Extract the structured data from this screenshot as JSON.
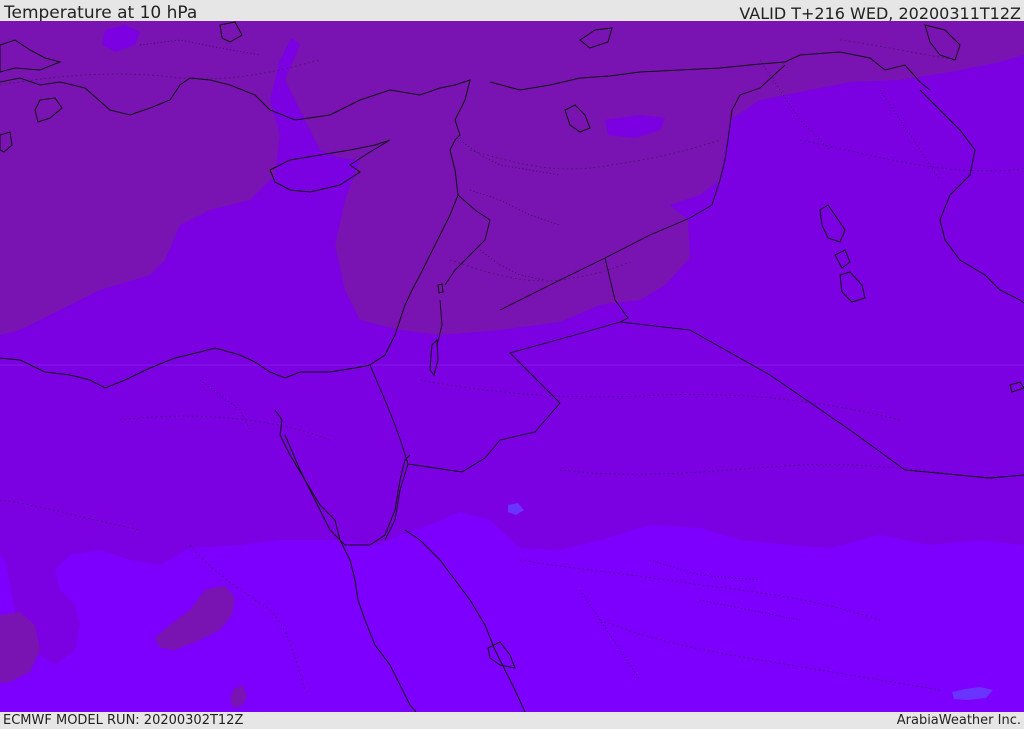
{
  "header": {
    "title": "Temperature at 10 hPa",
    "valid": "VALID T+216 WED, 20200311T12Z"
  },
  "footer": {
    "model_run": "ECMWF MODEL RUN: 20200302T12Z",
    "credit": "ArabiaWeather Inc."
  },
  "map": {
    "colors": {
      "dark_band": "#7913b2",
      "mid_band": "#7b00e2",
      "light_band": "#7d00ff",
      "light_patch": "#6a33ff",
      "coastline": "#111111",
      "border": "#111111"
    }
  }
}
